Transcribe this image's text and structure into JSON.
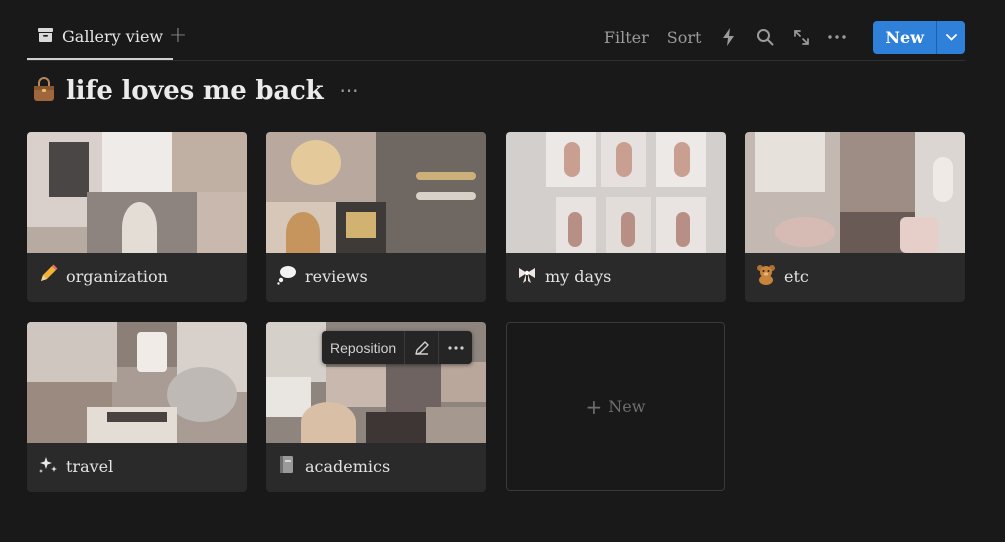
{
  "toolbar": {
    "view_tab_label": "Gallery view",
    "add_view_symbol": "+",
    "filter_label": "Filter",
    "sort_label": "Sort",
    "new_button_label": "New",
    "icons": [
      "archive-icon",
      "lightning-icon",
      "search-icon",
      "expand-icon",
      "more-icon",
      "chevron-down-icon"
    ]
  },
  "page": {
    "title": "life loves me back",
    "title_emoji": "handbag-icon",
    "more_symbol": "···"
  },
  "cards": [
    {
      "label": "organization",
      "emoji": "pencil-icon"
    },
    {
      "label": "reviews",
      "emoji": "thought-bubble-icon"
    },
    {
      "label": "my days",
      "emoji": "bow-icon"
    },
    {
      "label": "etc",
      "emoji": "teddy-bear-icon"
    },
    {
      "label": "travel",
      "emoji": "sparkles-icon"
    },
    {
      "label": "academics",
      "emoji": "book-icon"
    }
  ],
  "cover_controls": {
    "reposition_label": "Reposition",
    "more_symbol": "···"
  },
  "new_card": {
    "plus": "+",
    "label": "New"
  },
  "colors": {
    "background": "#191919",
    "card": "#2a2a2a",
    "accent": "#2f80d9",
    "text": "#e2e2e2",
    "muted": "#9b9b9b"
  }
}
